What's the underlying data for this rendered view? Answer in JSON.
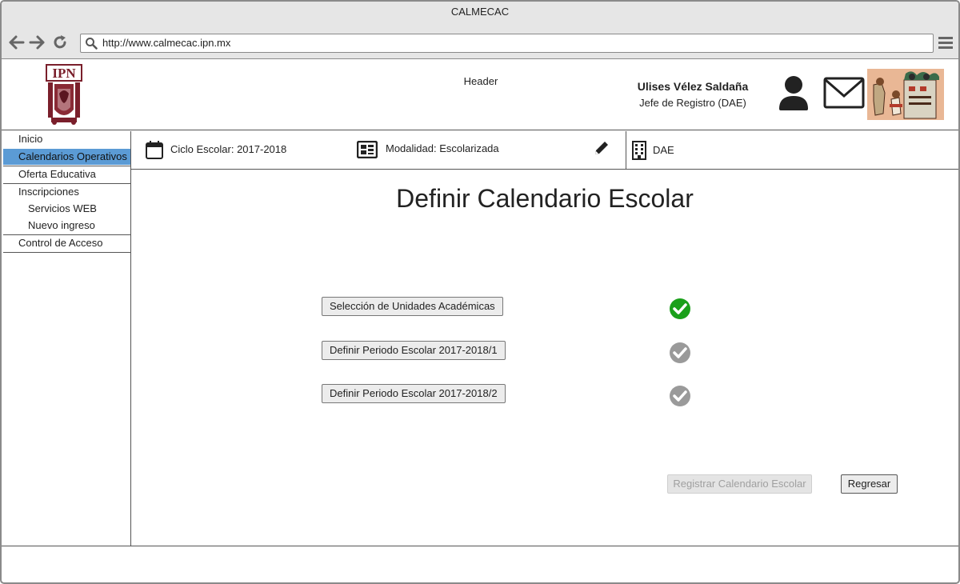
{
  "window": {
    "title": "CALMECAC"
  },
  "browser": {
    "url": "http://www.calmecac.ipn.mx"
  },
  "header": {
    "label": "Header",
    "user_name": "Ulises Vélez Saldaña",
    "user_role": "Jefe de Registro (DAE)",
    "logo_text": "IPN"
  },
  "sidebar": {
    "items": [
      {
        "label": "Inicio"
      },
      {
        "label": "Calendarios Operativos"
      },
      {
        "label": "Oferta Educativa"
      },
      {
        "label": "Inscripciones"
      },
      {
        "label": "Servicios WEB"
      },
      {
        "label": "Nuevo ingreso"
      },
      {
        "label": "Control de Acceso"
      }
    ]
  },
  "infobar": {
    "ciclo": "Ciclo Escolar: 2017-2018",
    "modalidad": "Modalidad: Escolarizada",
    "dependencia": "DAE"
  },
  "main": {
    "title": "Definir Calendario Escolar",
    "steps": [
      {
        "label": "Selección de Unidades Académicas",
        "status": "complete",
        "status_color": "#1aa01a"
      },
      {
        "label": "Definir Periodo Escolar 2017-2018/1",
        "status": "pending",
        "status_color": "#9a9a9a"
      },
      {
        "label": "Definir Periodo Escolar 2017-2018/2",
        "status": "pending",
        "status_color": "#9a9a9a"
      }
    ],
    "register_button": "Registrar Calendario Escolar",
    "back_button": "Regresar"
  },
  "colors": {
    "active_nav": "#5b9bd5",
    "chrome": "#e6e6e6",
    "logo": "#7a1f2b"
  }
}
